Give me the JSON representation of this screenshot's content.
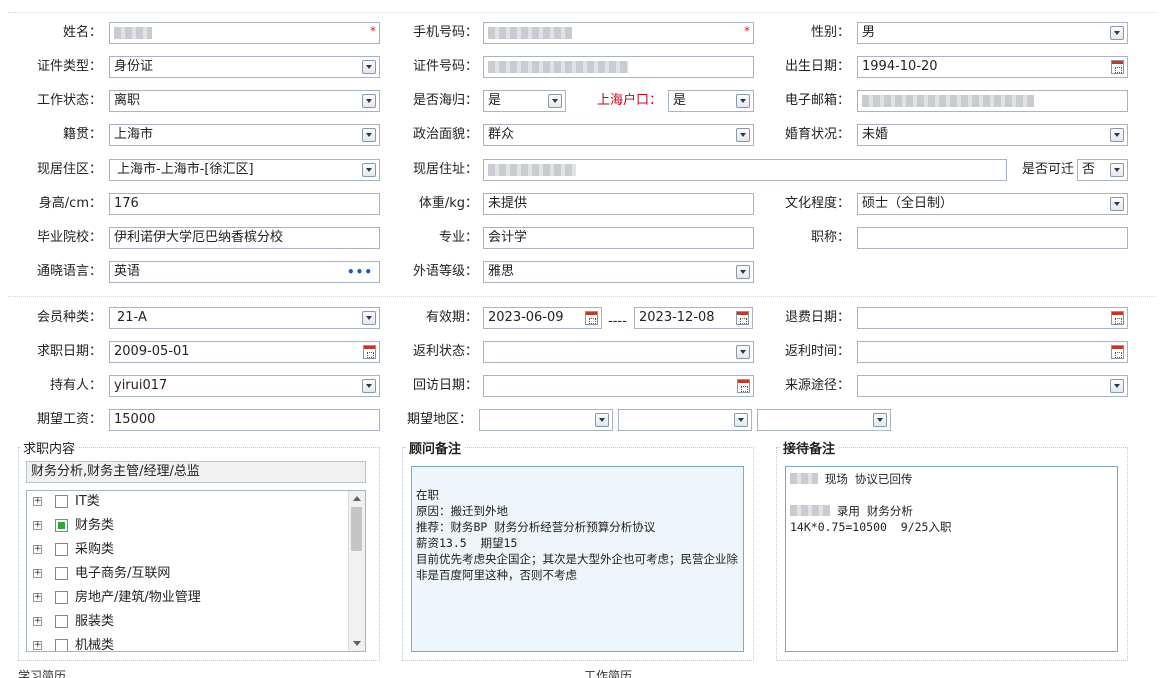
{
  "row1": {
    "name_label": "姓名：",
    "name_required": "*",
    "phone_label": "手机号码：",
    "phone_required": "*",
    "gender_label": "性别：",
    "gender_value": "男"
  },
  "row2": {
    "idtype_label": "证件类型：",
    "idtype_value": "身份证",
    "idno_label": "证件号码：",
    "birth_label": "出生日期：",
    "birth_value": "1994-10-20"
  },
  "row3": {
    "workstatus_label": "工作状态：",
    "workstatus_value": "离职",
    "returnee_label": "是否海归：",
    "returnee_value": "是",
    "hukou_label": "上海户口：",
    "hukou_value": "是",
    "email_label": "电子邮箱："
  },
  "row4": {
    "native_label": "籍贯：",
    "native_value": "上海市",
    "political_label": "政治面貌：",
    "political_value": "群众",
    "marital_label": "婚育状况：",
    "marital_value": "未婚"
  },
  "row5": {
    "district_label": "现居住区：",
    "district_value": "上海市-上海市-[徐汇区]",
    "address_label": "现居住址：",
    "relocate_label": "是否可迁",
    "relocate_value": "否"
  },
  "row6": {
    "height_label": "身高/cm：",
    "height_value": "176",
    "weight_label": "体重/kg：",
    "weight_value": "未提供",
    "education_label": "文化程度：",
    "education_value": "硕士（全日制）"
  },
  "row7": {
    "school_label": "毕业院校：",
    "school_value": "伊利诺伊大学厄巴纳香槟分校",
    "major_label": "专业：",
    "major_value": "会计学",
    "title_label": "职称：",
    "title_value": ""
  },
  "row8": {
    "language_label": "通晓语言：",
    "language_value": "英语",
    "langlevel_label": "外语等级：",
    "langlevel_value": "雅思"
  },
  "row9": {
    "membertype_label": "会员种类：",
    "membertype_value": "21-A",
    "validity_label": "有效期：",
    "validity_from": "2023-06-09",
    "validity_sep": "----",
    "validity_to": "2023-12-08",
    "refund_date_label": "退费日期："
  },
  "row10": {
    "jobdate_label": "求职日期：",
    "jobdate_value": "2009-05-01",
    "rebate_status_label": "返利状态：",
    "rebate_time_label": "返利时间："
  },
  "row11": {
    "holder_label": "持有人：",
    "holder_value": "yirui017",
    "revisit_label": "回访日期：",
    "source_label": "来源途径："
  },
  "row12": {
    "salary_label": "期望工资：",
    "salary_value": "15000",
    "area_label": "期望地区："
  },
  "job_content": {
    "title": "求职内容",
    "selected": "财务分析,财务主管/经理/总监",
    "tree": [
      {
        "label": "IT类",
        "checked": false
      },
      {
        "label": "财务类",
        "checked": true
      },
      {
        "label": "采购类",
        "checked": false
      },
      {
        "label": "电子商务/互联网",
        "checked": false
      },
      {
        "label": "房地产/建筑/物业管理",
        "checked": false
      },
      {
        "label": "服装类",
        "checked": false
      },
      {
        "label": "机械类",
        "checked": false
      }
    ]
  },
  "advisor_notes": {
    "title": "顾问备注",
    "text": "\n在职\n原因：搬迁到外地\n推荐：财务BP 财务分析经营分析预算分析协议\n薪资13.5  期望15\n目前优先考虑央企国企；其次是大型外企也可考虑；民营企业除非是百度阿里这种，否则不考虑"
  },
  "reception_notes": {
    "title": "接待备注",
    "line1": " 现场 协议已回传",
    "line2": " 录用 财务分析",
    "line3": "14K*0.75=10500  9/25入职"
  },
  "bottom": {
    "left": "学习简历",
    "right": "工作简历"
  }
}
